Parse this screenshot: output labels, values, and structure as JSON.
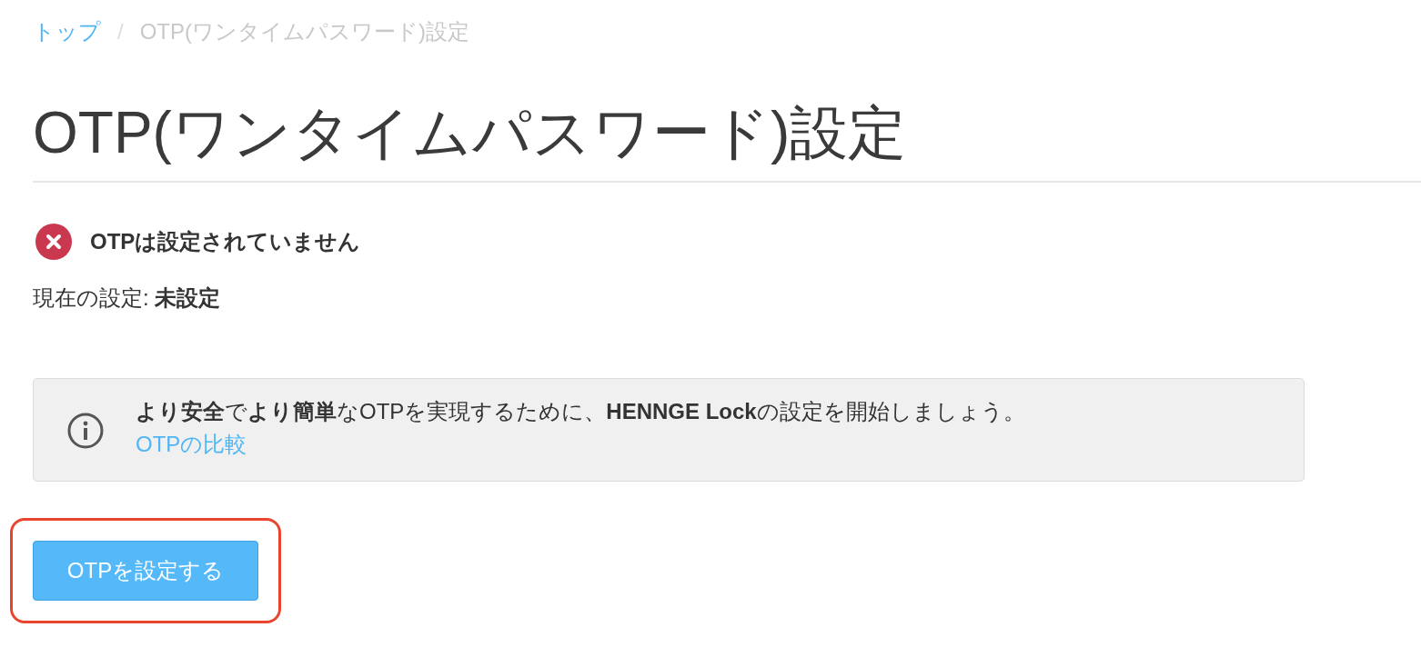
{
  "breadcrumb": [
    {
      "label": "トップ",
      "kind": "link"
    },
    {
      "label": "OTP(ワンタイムパスワード)設定",
      "kind": "current"
    }
  ],
  "breadcrumb_separator": "/",
  "title": "OTP(ワンタイムパスワード)設定",
  "status": {
    "configured": false,
    "message": "OTPは設定されていません",
    "current_setting": "現在の設定: **未設定**"
  },
  "info": {
    "text": "**より安全**で**より簡単**なOTPを実現するために、**HENNGE Lock**の設定を開始しましょう。",
    "link": "OTPの比較"
  },
  "action": {
    "label": "OTPを設定する",
    "highlighted": true
  }
}
